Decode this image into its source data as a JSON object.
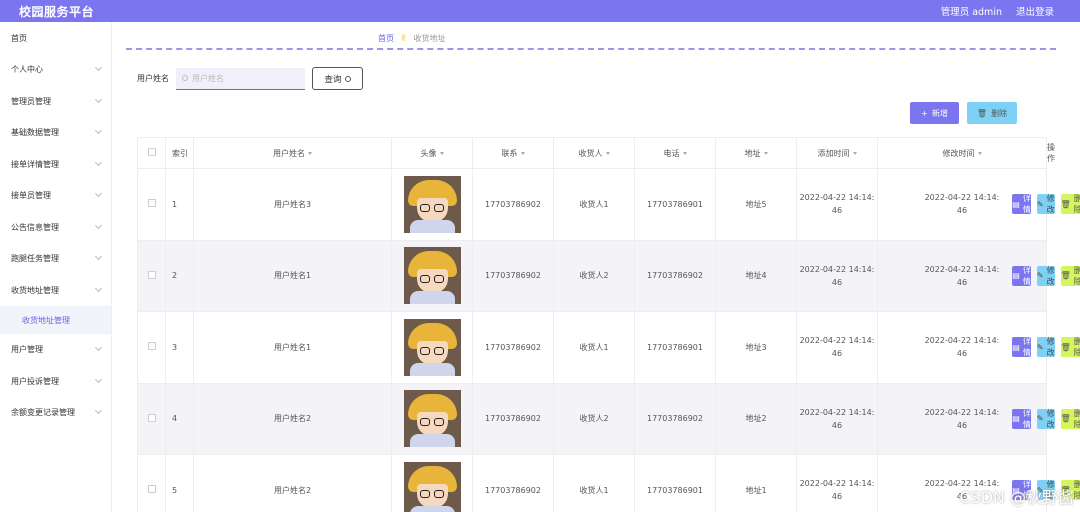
{
  "header": {
    "title": "校园服务平台",
    "user": "管理员 admin",
    "logout": "退出登录"
  },
  "sidebar": {
    "items": [
      {
        "label": "首页",
        "chevron": false
      },
      {
        "label": "个人中心",
        "chevron": true
      },
      {
        "label": "管理员管理",
        "chevron": true
      },
      {
        "label": "基础数据管理",
        "chevron": true
      },
      {
        "label": "接单详情管理",
        "chevron": true
      },
      {
        "label": "接单员管理",
        "chevron": true
      },
      {
        "label": "公告信息管理",
        "chevron": true
      },
      {
        "label": "跑腿任务管理",
        "chevron": true
      },
      {
        "label": "收货地址管理",
        "chevron": true
      },
      {
        "label": "收货地址管理",
        "sub": true
      },
      {
        "label": "用户管理",
        "chevron": true
      },
      {
        "label": "用户投诉管理",
        "chevron": true
      },
      {
        "label": "余额变更记录管理",
        "chevron": true
      }
    ]
  },
  "breadcrumb": {
    "home": "首页",
    "sep": "✌",
    "current": "收货地址"
  },
  "search": {
    "label": "用户姓名",
    "placeholder": "用户姓名",
    "button": "查询"
  },
  "toolbar": {
    "add": "新增",
    "delete": "删除"
  },
  "table": {
    "headers": [
      "索引",
      "用户姓名",
      "头像",
      "联系",
      "收货人",
      "电话",
      "地址",
      "添加时间",
      "修改时间",
      "操作"
    ],
    "rows": [
      {
        "index": "1",
        "name": "用户姓名3",
        "contact": "17703786902",
        "receiver": "收货人1",
        "phone": "17703786901",
        "address": "地址5",
        "added_a": "2022-04-22 14:14:",
        "added_b": "46",
        "modified_a": "2022-04-22 14:14:",
        "modified_b": "46"
      },
      {
        "index": "2",
        "name": "用户姓名1",
        "contact": "17703786902",
        "receiver": "收货人2",
        "phone": "17703786902",
        "address": "地址4",
        "added_a": "2022-04-22 14:14:",
        "added_b": "46",
        "modified_a": "2022-04-22 14:14:",
        "modified_b": "46"
      },
      {
        "index": "3",
        "name": "用户姓名1",
        "contact": "17703786902",
        "receiver": "收货人1",
        "phone": "17703786901",
        "address": "地址3",
        "added_a": "2022-04-22 14:14:",
        "added_b": "46",
        "modified_a": "2022-04-22 14:14:",
        "modified_b": "46"
      },
      {
        "index": "4",
        "name": "用户姓名2",
        "contact": "17703786902",
        "receiver": "收货人2",
        "phone": "17703786902",
        "address": "地址2",
        "added_a": "2022-04-22 14:14:",
        "added_b": "46",
        "modified_a": "2022-04-22 14:14:",
        "modified_b": "46"
      },
      {
        "index": "5",
        "name": "用户姓名2",
        "contact": "17703786902",
        "receiver": "收货人1",
        "phone": "17703786901",
        "address": "地址1",
        "added_a": "2022-04-22 14:14:",
        "added_b": "46",
        "modified_a": "2022-04-22 14:14:",
        "modified_b": "46"
      }
    ],
    "actions": {
      "detail": "详情",
      "edit": "修改",
      "delete": "删除"
    }
  },
  "watermark": "CSDN @秋野酱",
  "colors": {
    "primary": "#7b76f0",
    "edit": "#7fd0f5",
    "delete": "#d4f55c"
  }
}
